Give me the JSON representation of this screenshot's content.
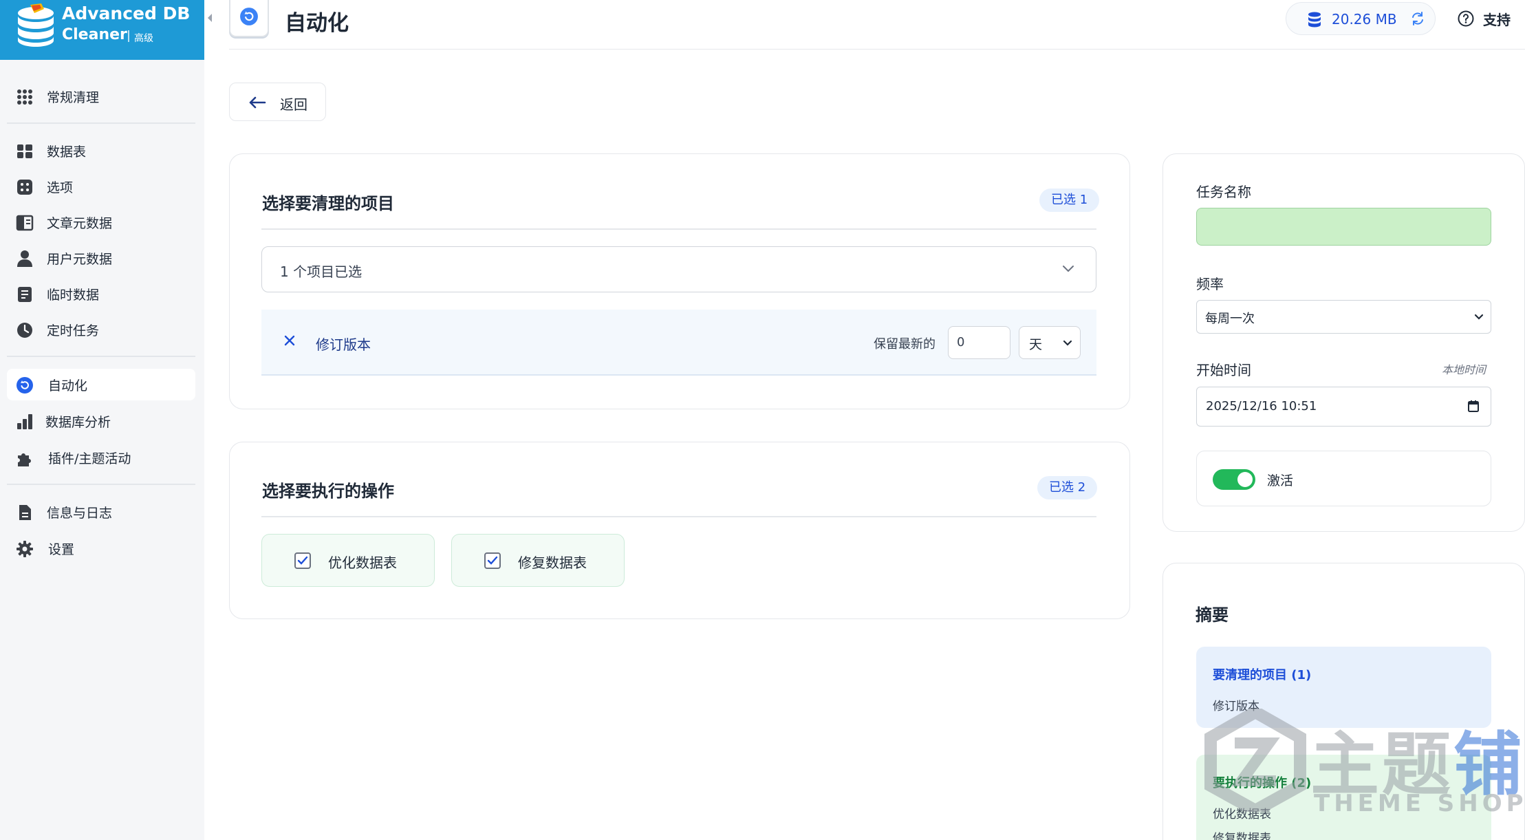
{
  "brand": {
    "name_line1": "Advanced DB",
    "name_line2": "Cleaner",
    "tier": "高级"
  },
  "sidebar": {
    "items": [
      {
        "label": "常规清理",
        "icon": "grid-dots-icon"
      },
      {
        "label": "数据表",
        "icon": "table-icon"
      },
      {
        "label": "选项",
        "icon": "options-icon"
      },
      {
        "label": "文章元数据",
        "icon": "post-meta-icon"
      },
      {
        "label": "用户元数据",
        "icon": "user-icon"
      },
      {
        "label": "临时数据",
        "icon": "transient-icon"
      },
      {
        "label": "定时任务",
        "icon": "clock-icon"
      },
      {
        "label": "自动化",
        "icon": "automation-icon",
        "active": true
      },
      {
        "label": "数据库分析",
        "icon": "bar-chart-icon"
      },
      {
        "label": "插件/主题活动",
        "icon": "puzzle-icon"
      },
      {
        "label": "信息与日志",
        "icon": "document-icon"
      },
      {
        "label": "设置",
        "icon": "gear-icon"
      }
    ]
  },
  "header": {
    "title": "自动化",
    "db_size": "20.26 MB",
    "support_label": "支持"
  },
  "back_label": "返回",
  "items_card": {
    "title": "选择要清理的项目",
    "badge": "已选 1",
    "select_label": "1 个项目已选",
    "selected_item": {
      "name": "修订版本",
      "keep_label": "保留最新的",
      "keep_value": "0",
      "unit": "天"
    }
  },
  "ops_card": {
    "title": "选择要执行的操作",
    "badge": "已选 2",
    "ops": [
      {
        "label": "优化数据表",
        "checked": true
      },
      {
        "label": "修复数据表",
        "checked": true
      }
    ]
  },
  "task_panel": {
    "name_label": "任务名称",
    "name_value": "",
    "freq_label": "频率",
    "freq_value": "每周一次",
    "start_label": "开始时间",
    "local_time_label": "本地时间",
    "start_value": "2025/12/16  10:51",
    "active_label": "激活",
    "active": true
  },
  "summary": {
    "title": "摘要",
    "items_heading": "要清理的项目 (1)",
    "items": [
      "修订版本"
    ],
    "ops_heading": "要执行的操作 (2)",
    "ops": [
      "优化数据表",
      "修复数据表"
    ]
  },
  "watermark": {
    "text_main_a": "主题",
    "text_main_b": "铺",
    "text_sub": "THEME SHOP"
  },
  "colors": {
    "brand": "#1e9ad6",
    "accent": "#1d4ed8",
    "toggle_on": "#22b85a",
    "name_input_bg": "#cbf0c8"
  }
}
